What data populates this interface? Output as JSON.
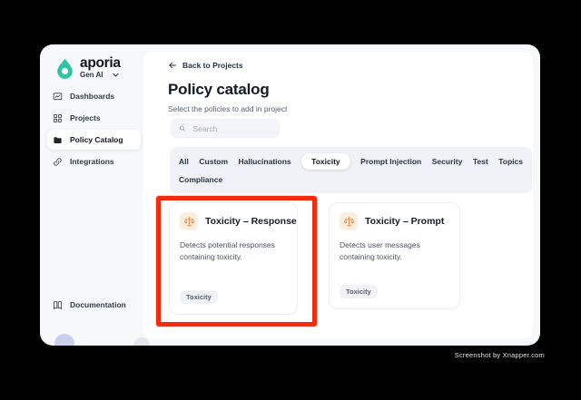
{
  "app": {
    "brand": "aporia",
    "workspace": "Gen AI"
  },
  "sidebar": {
    "items": [
      {
        "label": "Dashboards",
        "icon": "dashboard-icon",
        "active": false
      },
      {
        "label": "Projects",
        "icon": "grid-icon",
        "active": false
      },
      {
        "label": "Policy Catalog",
        "icon": "folder-icon",
        "active": true
      },
      {
        "label": "Integrations",
        "icon": "link-icon",
        "active": false
      }
    ],
    "footer_item": {
      "label": "Documentation",
      "icon": "book-icon"
    }
  },
  "main": {
    "back_link": "Back to Projects",
    "title": "Policy catalog",
    "subtitle": "Select the policies to add in project",
    "search": {
      "placeholder": "Search"
    },
    "tabs": [
      "All",
      "Custom",
      "Hallucinations",
      "Toxicity",
      "Prompt Injection",
      "Security",
      "Test",
      "Topics",
      "Compliance"
    ],
    "active_tab": "Toxicity",
    "cards": [
      {
        "title": "Toxicity – Response",
        "description": "Detects potential responses containing toxicity.",
        "tag": "Toxicity",
        "icon": "scales-icon",
        "highlighted": true
      },
      {
        "title": "Toxicity – Prompt",
        "description": "Detects user messages containing toxicity.",
        "tag": "Toxicity",
        "icon": "scales-icon",
        "highlighted": false
      }
    ]
  },
  "watermark": "Screenshot by Xnapper.com",
  "colors": {
    "highlight_red": "#F42B0C",
    "brand_teal": "#2EC5A3",
    "card_icon_orange": "#E8873B",
    "card_icon_bg": "#FBEEDD",
    "window_bg": "#F7F8FA",
    "panel_bg": "#FFFFFF",
    "tabs_bg": "#F1F2F7"
  }
}
